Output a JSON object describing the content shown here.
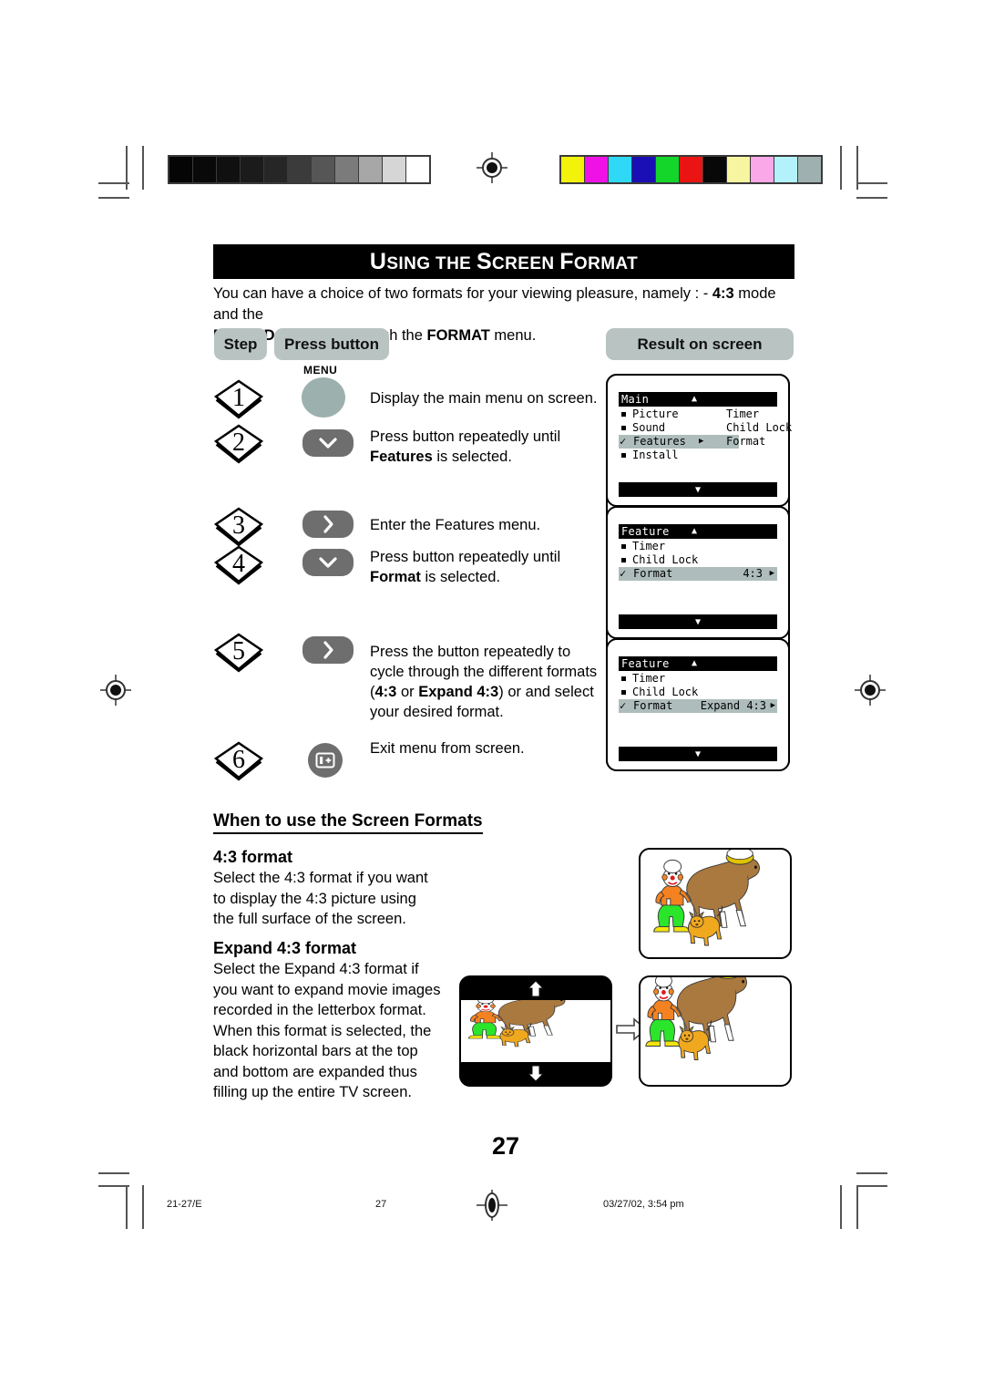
{
  "header": {
    "title_full": "Using the Screen Format"
  },
  "intro": {
    "line1_a": "You can have a choice of two formats for your viewing pleasure, namely : - ",
    "line1_b": "4:3",
    "line1_c": " mode and the",
    "line2_a": "EXPAND 4:3",
    "line2_b": " mode through the ",
    "line2_c": "FORMAT",
    "line2_d": " menu."
  },
  "table": {
    "col_step": "Step",
    "col_press": "Press button",
    "col_result": "Result on screen"
  },
  "steps": [
    {
      "num": "1",
      "button": "menu-round",
      "button_label": "MENU",
      "text_a": "Display the main menu on screen.",
      "text_b": "",
      "text_c": ""
    },
    {
      "num": "2",
      "button": "down-arrow",
      "button_label": "",
      "text_a": "Press button repeatedly until",
      "text_b": "Features",
      "text_c": " is selected."
    },
    {
      "num": "3",
      "button": "right-arrow",
      "button_label": "",
      "text_a": "Enter the Features menu.",
      "text_b": "",
      "text_c": ""
    },
    {
      "num": "4",
      "button": "down-arrow",
      "button_label": "",
      "text_a": "Press button repeatedly until",
      "text_b": "Format",
      "text_c": " is selected."
    },
    {
      "num": "5",
      "button": "right-arrow",
      "button_label": "",
      "text_a": "Press the button repeatedly to",
      "text_line2": "cycle through the different formats",
      "text_l3_a": "(",
      "text_l3_b": "4:3",
      "text_l3_c": " or ",
      "text_l3_d": "Expand 4:3",
      "text_l3_e": ") or and select",
      "text_line4": "your desired format.",
      "text_b": "",
      "text_c": ""
    },
    {
      "num": "6",
      "button": "exit-screen",
      "button_label": "",
      "text_a": "Exit menu from screen.",
      "text_b": "",
      "text_c": ""
    }
  ],
  "osd_screens": [
    {
      "title": "Main",
      "up_arrow": "▲",
      "down_arrow": "▼",
      "rows": [
        {
          "marker": "bullet",
          "label": "Picture",
          "col2": "Timer",
          "value": "",
          "arrow": "",
          "highlight": false
        },
        {
          "marker": "bullet",
          "label": "Sound",
          "col2": "Child Lock",
          "value": "",
          "arrow": "",
          "highlight": false
        },
        {
          "marker": "check",
          "label": "Features",
          "col2": "Format",
          "value": "",
          "arrow": "▶",
          "highlight": true
        },
        {
          "marker": "bullet",
          "label": "Install",
          "col2": "",
          "value": "",
          "arrow": "",
          "highlight": false
        }
      ]
    },
    {
      "title": "Feature",
      "up_arrow": "▲",
      "down_arrow": "▼",
      "rows": [
        {
          "marker": "bullet",
          "label": "Timer",
          "col2": "",
          "value": "",
          "arrow": "",
          "highlight": false
        },
        {
          "marker": "bullet",
          "label": "Child Lock",
          "col2": "",
          "value": "",
          "arrow": "",
          "highlight": false
        },
        {
          "marker": "check",
          "label": "Format",
          "col2": "",
          "value": "4:3",
          "arrow": "▶",
          "highlight": true
        }
      ]
    },
    {
      "title": "Feature",
      "up_arrow": "▲",
      "down_arrow": "▼",
      "rows": [
        {
          "marker": "bullet",
          "label": "Timer",
          "col2": "",
          "value": "",
          "arrow": "",
          "highlight": false
        },
        {
          "marker": "bullet",
          "label": "Child Lock",
          "col2": "",
          "value": "",
          "arrow": "",
          "highlight": false
        },
        {
          "marker": "check",
          "label": "Format",
          "col2": "",
          "value": "Expand 4:3",
          "arrow": "▶",
          "highlight": true
        }
      ]
    }
  ],
  "sections": {
    "when_heading": "When to use the Screen Formats",
    "fmt43_heading": "4:3 format",
    "fmt43_body": "Select the 4:3 format if you want to display the 4:3 picture using the full surface of the screen.",
    "expand_heading": "Expand 4:3 format",
    "expand_body": "Select the Expand 4:3 format if you want to expand movie images recorded in the letterbox format. When this format is selected, the black horizontal bars at the top and bottom are expanded thus filling up the entire TV screen."
  },
  "footer": {
    "page_number": "27",
    "file_ref": "21-27/E",
    "sheet_number": "27",
    "timestamp": "03/27/02, 3:54 pm"
  },
  "print_bars": {
    "gray_steps": [
      "#050505",
      "#090909",
      "#101010",
      "#1b1b1b",
      "#262626",
      "#3b3b3b",
      "#565656",
      "#7b7b7b",
      "#a7a7a7",
      "#d6d6d6",
      "#ffffff"
    ],
    "color_steps": [
      "#f2f20a",
      "#ef11e5",
      "#2fd8f5",
      "#1a0fb5",
      "#14d62a",
      "#ea1413",
      "#080808",
      "#f8f5a0",
      "#fba8e8",
      "#b3f2fb",
      "#9fb0b0"
    ]
  },
  "colors": {
    "pill": "#b9c4c2",
    "menu_button": "#9cb0ae",
    "arrow_button": "#6e6e6e",
    "osd_highlight": "#aebdbb",
    "title_bar": "#000000"
  },
  "illustration": {
    "name": "circus-clown-horse-dog",
    "clown_shirt": "#f58220",
    "clown_pants": "#2ae52a",
    "clown_shoes": "#f2e40d",
    "horse_body": "#a9793f",
    "dog_body": "#f0a81e",
    "hat_band": "#e0c200"
  }
}
